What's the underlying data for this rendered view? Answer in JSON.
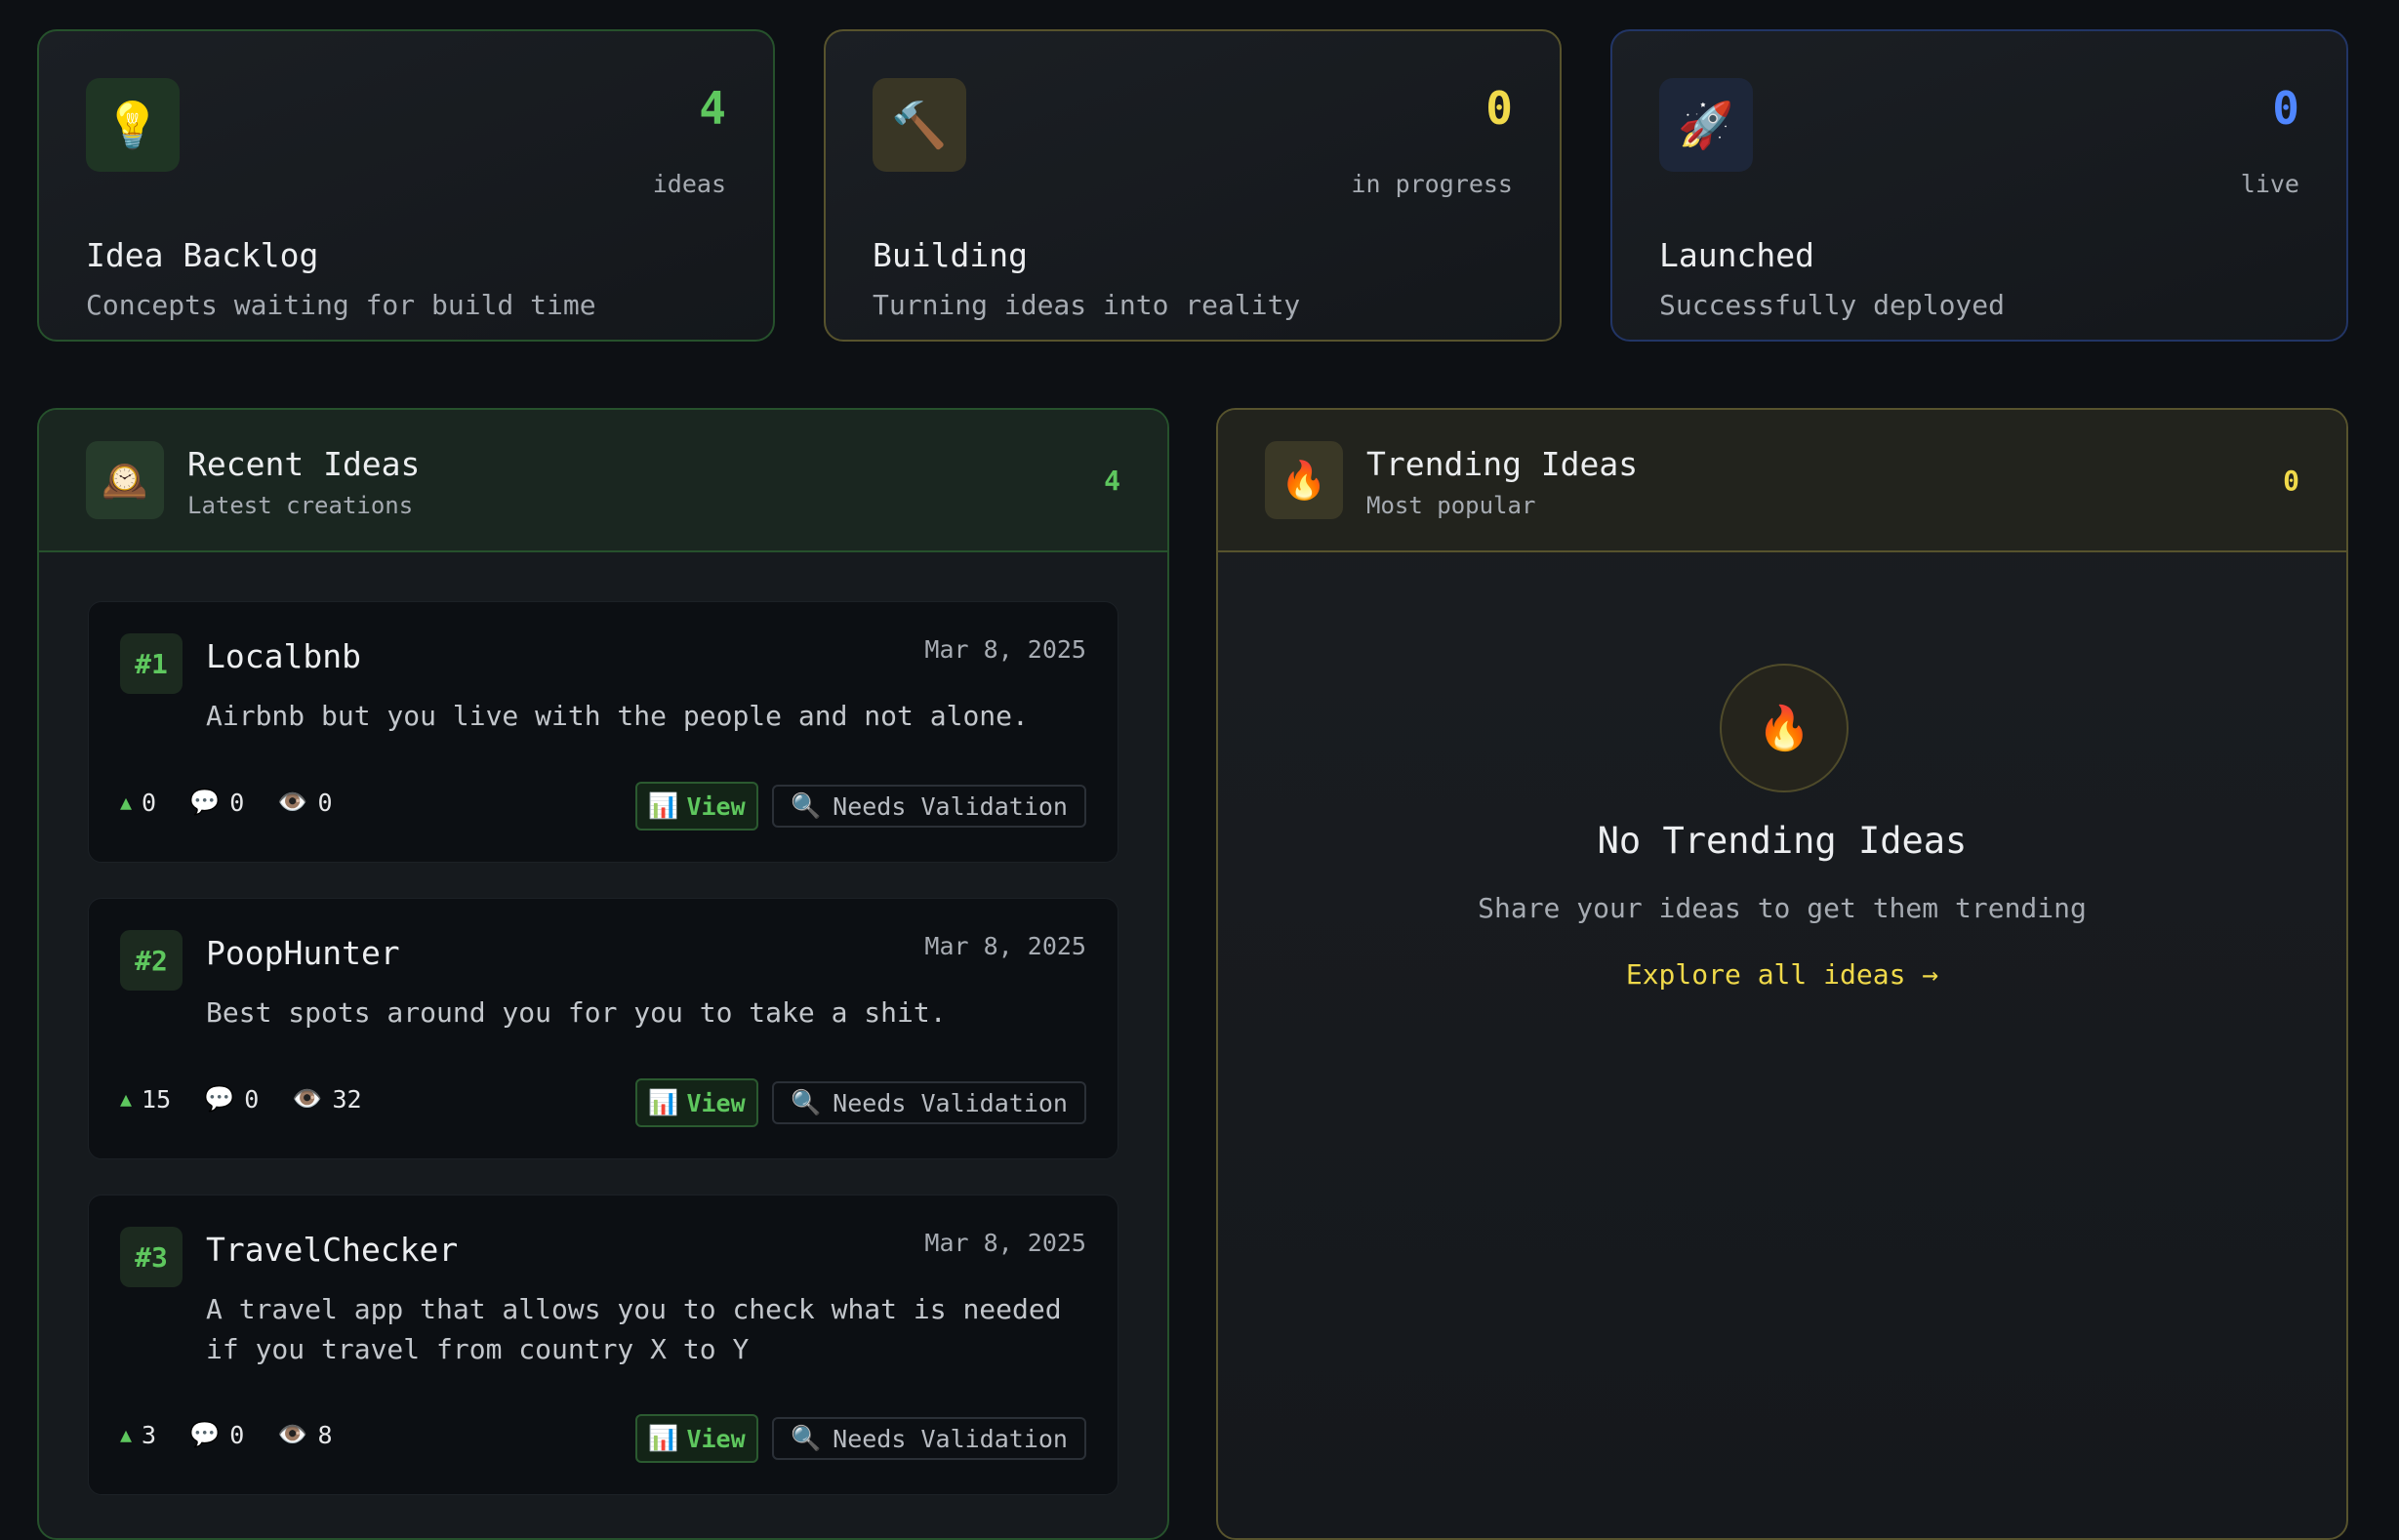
{
  "stats": [
    {
      "icon": "💡",
      "count": "4",
      "unit": "ideas",
      "title": "Idea Backlog",
      "subtitle": "Concepts waiting for build time"
    },
    {
      "icon": "🔨",
      "count": "0",
      "unit": "in progress",
      "title": "Building",
      "subtitle": "Turning ideas into reality"
    },
    {
      "icon": "🚀",
      "count": "0",
      "unit": "live",
      "title": "Launched",
      "subtitle": "Successfully deployed"
    }
  ],
  "recent": {
    "icon": "🕰️",
    "title": "Recent Ideas",
    "subtitle": "Latest creations",
    "count": "4",
    "ideas": [
      {
        "rank": "#1",
        "title": "Localbnb",
        "date": "Mar 8, 2025",
        "description": "Airbnb but you live with the people and not alone.",
        "upvotes": "0",
        "comments": "0",
        "views": "0",
        "view_label": "View",
        "status": "Needs Validation"
      },
      {
        "rank": "#2",
        "title": "PoopHunter",
        "date": "Mar 8, 2025",
        "description": "Best spots around you for you to take a shit.",
        "upvotes": "15",
        "comments": "0",
        "views": "32",
        "view_label": "View",
        "status": "Needs Validation"
      },
      {
        "rank": "#3",
        "title": "TravelChecker",
        "date": "Mar 8, 2025",
        "description": "A travel app that allows you to check what is needed if you travel from country X to Y",
        "upvotes": "3",
        "comments": "0",
        "views": "8",
        "view_label": "View",
        "status": "Needs Validation"
      }
    ]
  },
  "trending": {
    "icon": "🔥",
    "title": "Trending Ideas",
    "subtitle": "Most popular",
    "count": "0",
    "empty_icon": "🔥",
    "empty_title": "No Trending Ideas",
    "empty_subtitle": "Share your ideas to get them trending",
    "explore_label": "Explore all ideas →"
  },
  "icons": {
    "upvote": "▲",
    "comment": "💬",
    "view": "👁️",
    "chart": "📊",
    "search": "🔍"
  },
  "colors": {
    "green": "#5ec75e",
    "yellow": "#f0d94a",
    "blue": "#4f86ff",
    "background": "#0d1014"
  }
}
